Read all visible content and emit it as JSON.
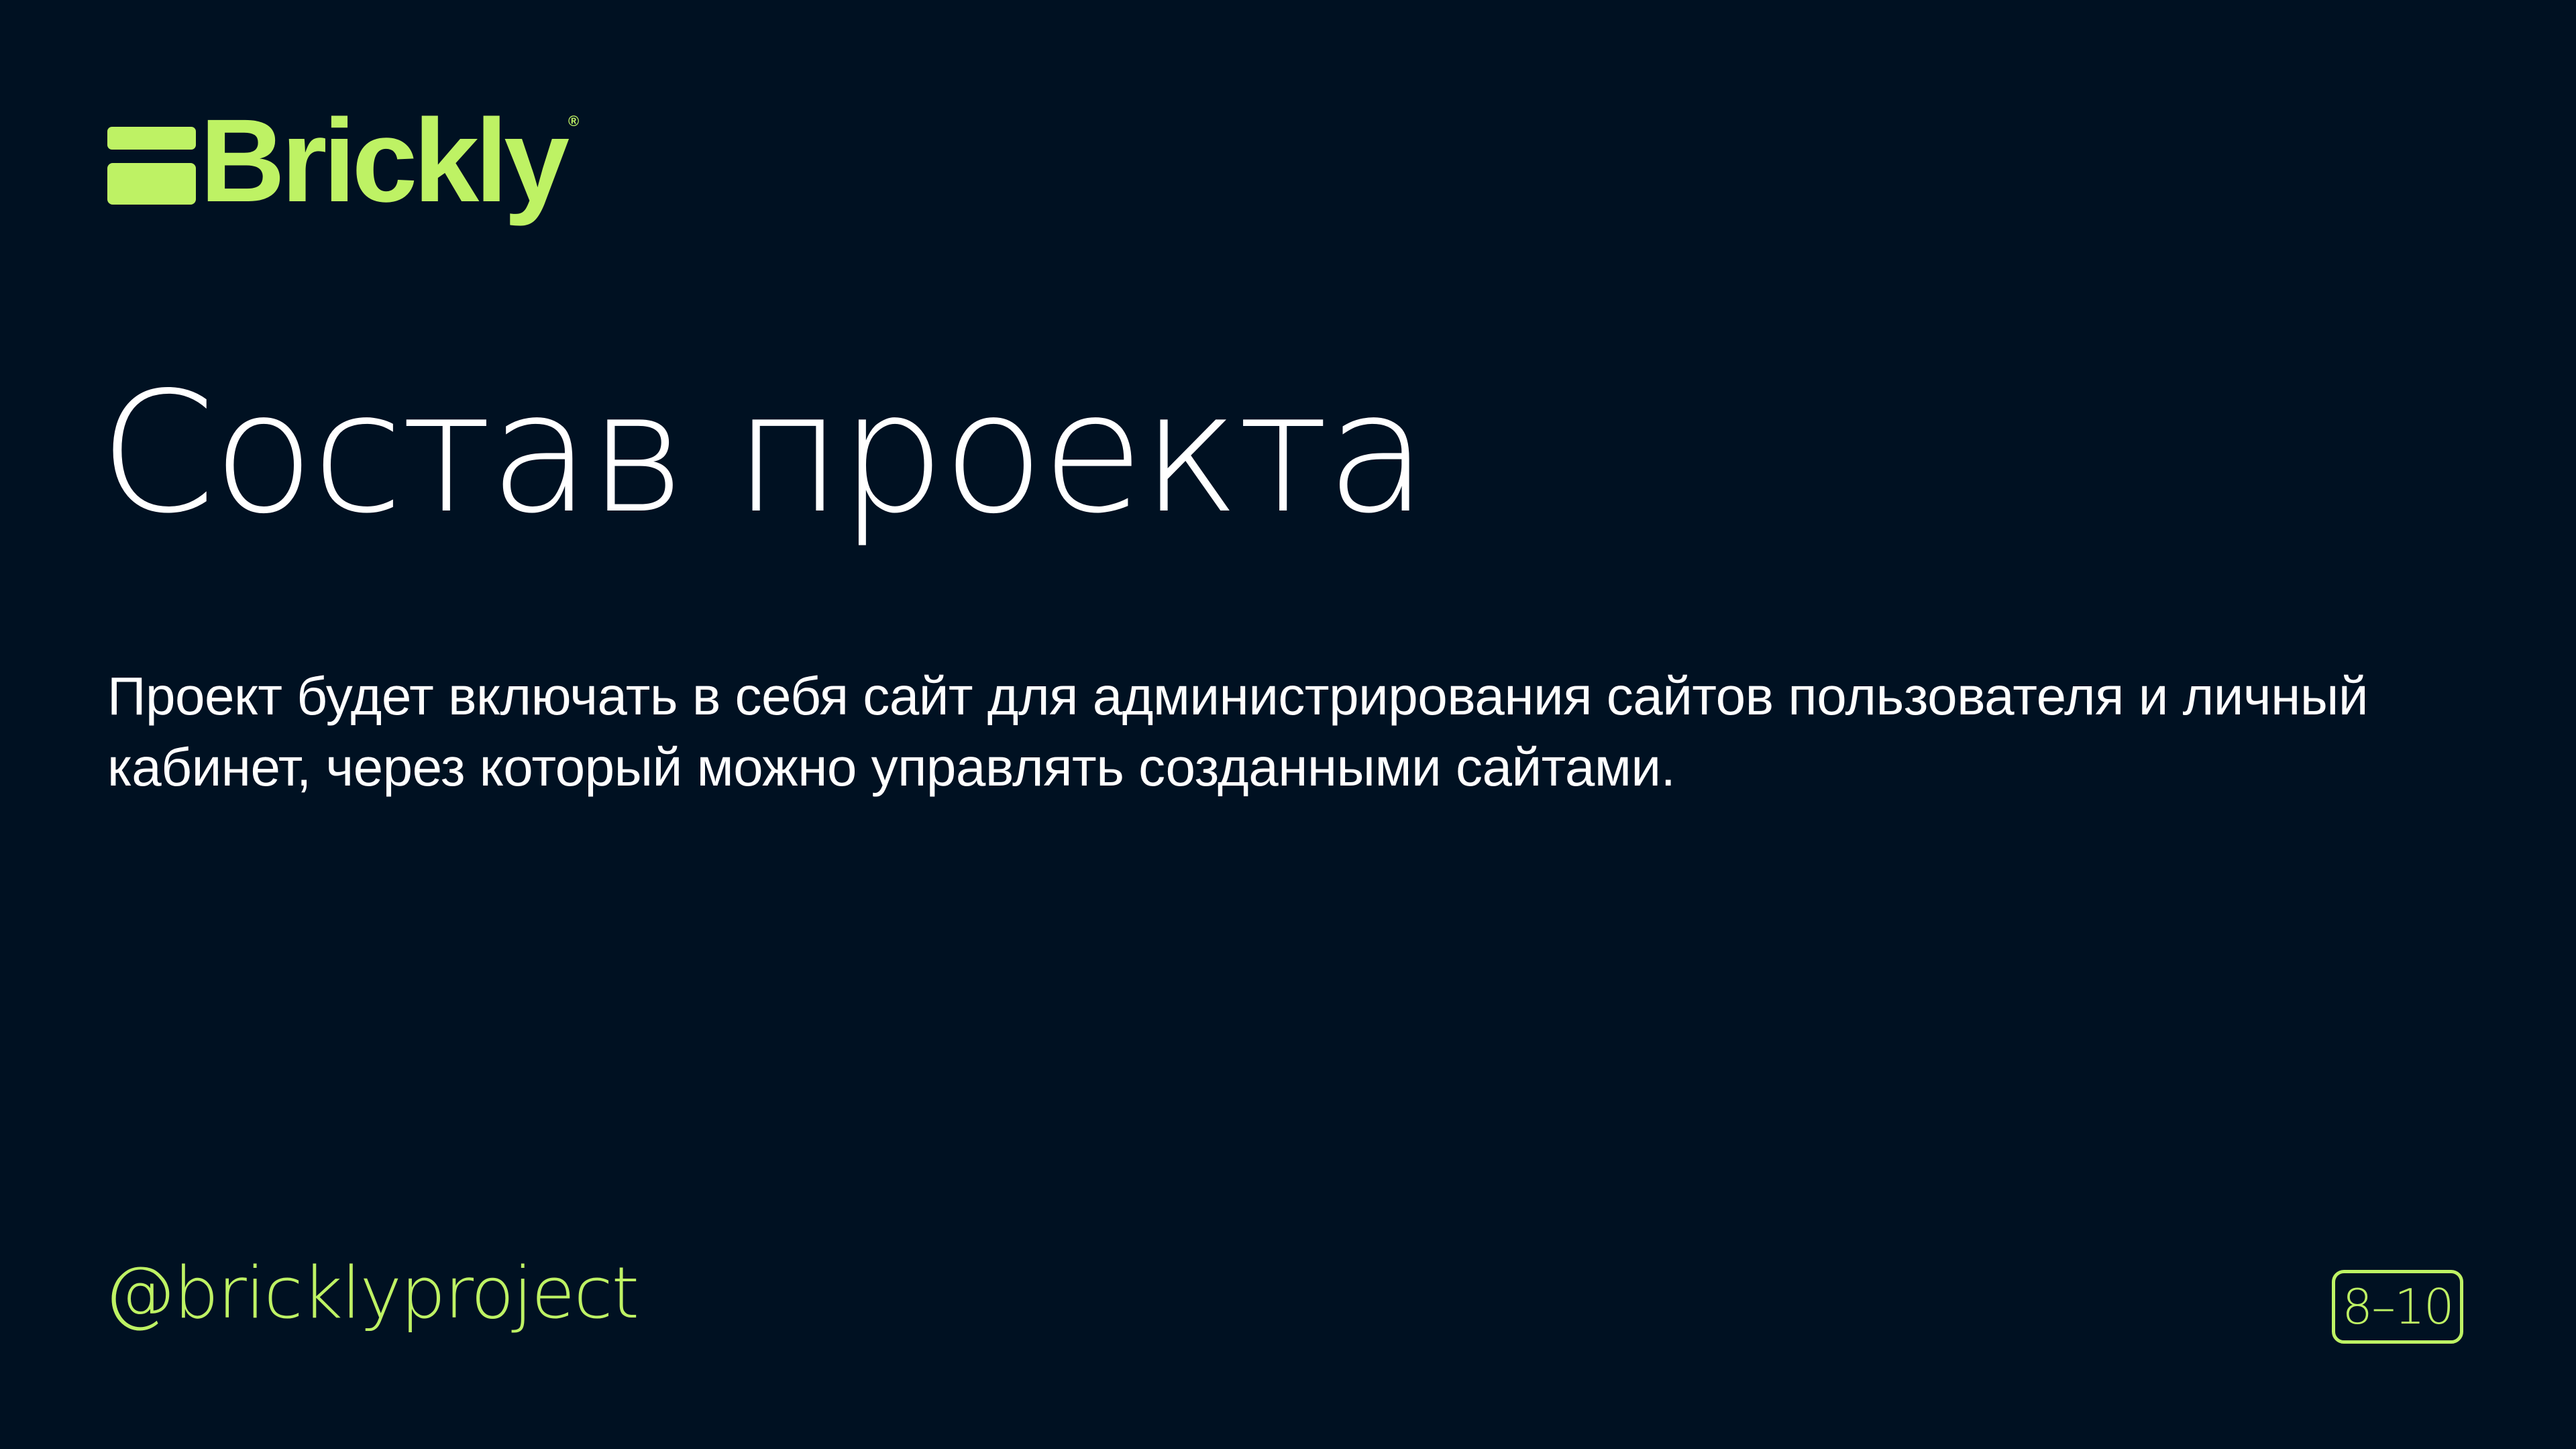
{
  "brand": {
    "name": "Brickly",
    "registered_mark": "®",
    "accent_color": "#BEF264",
    "background_color": "#001122"
  },
  "slide": {
    "title": "Состав проекта",
    "body": "Проект будет включать в себя сайт для администрирования сайтов пользователя и личный кабинет, через который можно управлять созданными сайтами.",
    "handle": "@bricklyproject",
    "page_indicator": "8–10"
  }
}
